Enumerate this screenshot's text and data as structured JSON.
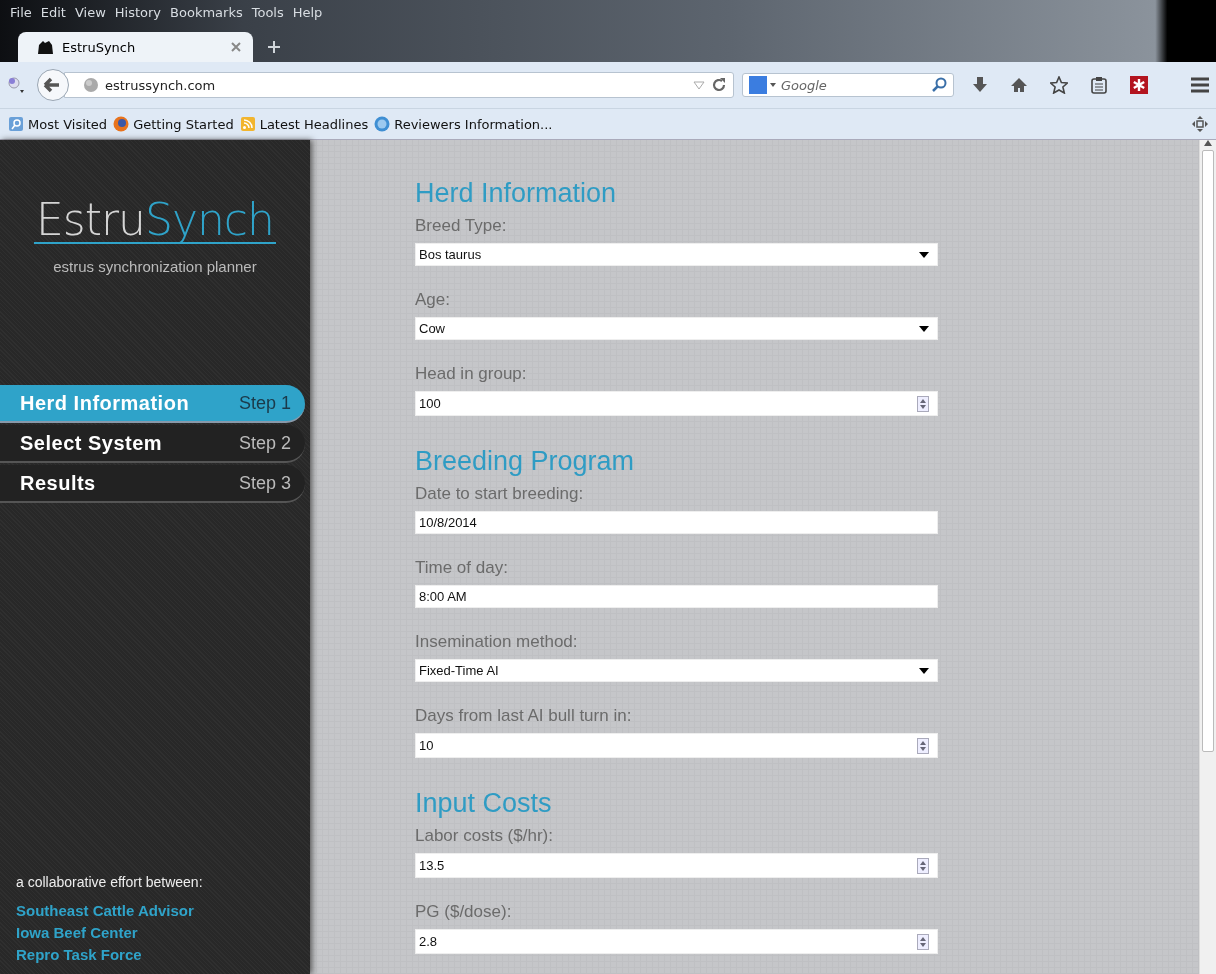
{
  "browser": {
    "menu": [
      "File",
      "Edit",
      "View",
      "History",
      "Bookmarks",
      "Tools",
      "Help"
    ],
    "tabs": [
      {
        "title": "EstruSynch",
        "selected": true
      }
    ],
    "address": "estrussynch.com",
    "search": {
      "placeholder": "Google"
    },
    "bookmarks": [
      {
        "label": "Most Visited",
        "kind": "search"
      },
      {
        "label": "Getting Started",
        "kind": "firefox"
      },
      {
        "label": "Latest Headlines",
        "kind": "rss"
      },
      {
        "label": "Reviewers Information...",
        "kind": "globe"
      }
    ]
  },
  "sidebar": {
    "logo": [
      "Estru",
      "Synch"
    ],
    "tagline": "estrus synchronization planner",
    "steps": [
      {
        "label": "Herd Information",
        "step": "Step 1",
        "selected": true
      },
      {
        "label": "Select System",
        "step": "Step 2",
        "selected": false
      },
      {
        "label": "Results",
        "step": "Step 3",
        "selected": false
      }
    ],
    "credit": "a collaborative effort between:",
    "partners": [
      "Southeast Cattle Advisor",
      "Iowa Beef Center",
      "Repro Task Force"
    ]
  },
  "sections": [
    {
      "title": "Herd Information",
      "fields": [
        {
          "label": "Breed Type:",
          "kind": "select",
          "value": "Bos taurus"
        },
        {
          "label": "Age:",
          "kind": "select",
          "value": "Cow"
        },
        {
          "label": "Head in group:",
          "kind": "number",
          "value": "100"
        }
      ]
    },
    {
      "title": "Breeding Program",
      "fields": [
        {
          "label": "Date to start breeding:",
          "kind": "text",
          "value": "10/8/2014"
        },
        {
          "label": "Time of day:",
          "kind": "text",
          "value": "8:00 AM"
        },
        {
          "label": "Insemination method:",
          "kind": "select",
          "value": "Fixed-Time AI"
        },
        {
          "label": "Days from last AI bull turn in:",
          "kind": "number",
          "value": "10"
        }
      ]
    },
    {
      "title": "Input Costs",
      "fields": [
        {
          "label": "Labor costs ($/hr):",
          "kind": "number",
          "value": "13.5"
        },
        {
          "label": "PG ($/dose):",
          "kind": "number",
          "value": "2.8"
        }
      ]
    }
  ]
}
